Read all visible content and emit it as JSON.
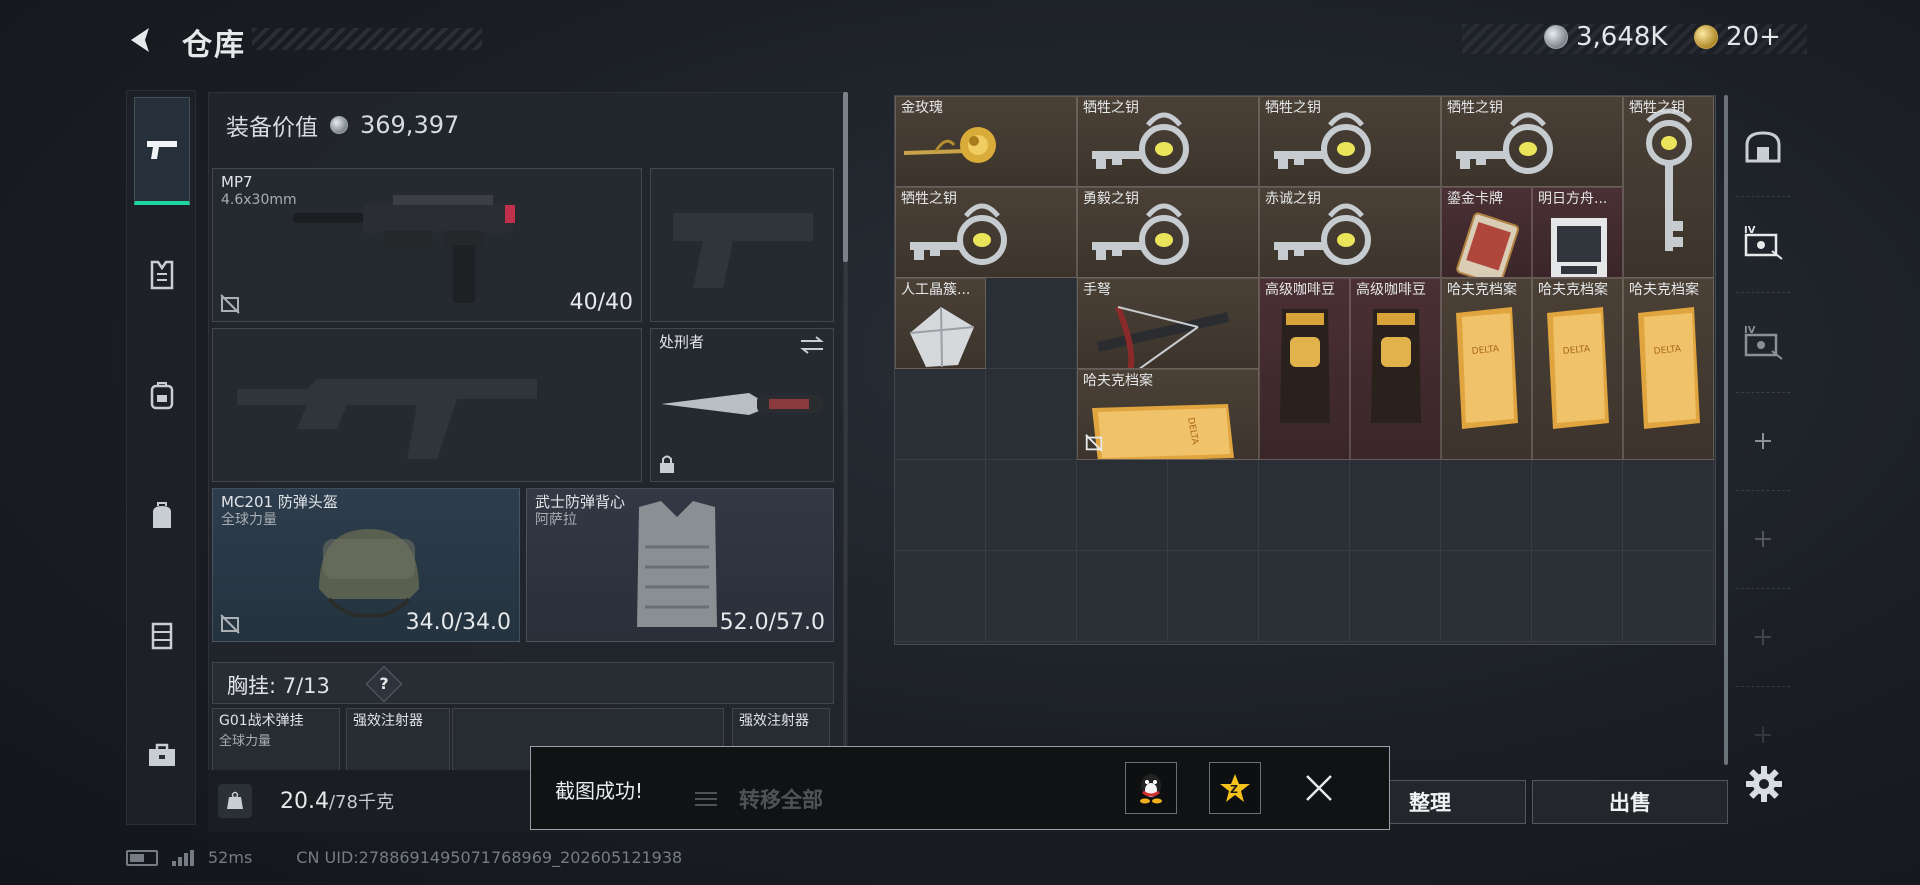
{
  "header": {
    "title": "仓库",
    "currency_1": "3,648K",
    "currency_2": "20+"
  },
  "left_nav": [
    {
      "name": "firearms",
      "icon": "pistol-icon",
      "active": true
    },
    {
      "name": "armor",
      "icon": "vest-icon",
      "active": false
    },
    {
      "name": "backpack",
      "icon": "backpack-icon",
      "active": false
    },
    {
      "name": "bag",
      "icon": "bag-icon",
      "active": false
    },
    {
      "name": "chest-rig",
      "icon": "rig-icon",
      "active": false
    },
    {
      "name": "case",
      "icon": "briefcase-icon",
      "active": false
    }
  ],
  "equipment": {
    "value_label": "装备价值",
    "value": "369,397",
    "primary_weapon": {
      "name": "MP7",
      "ammo": "4.6x30mm",
      "count": "40/40"
    },
    "melee": {
      "name": "处刑者"
    },
    "helmet": {
      "name": "MC201 防弹头盔",
      "sub": "全球力量",
      "durability": "34.0/34.0"
    },
    "vest": {
      "name": "武士防弹背心",
      "sub": "阿萨拉",
      "durability": "52.0/57.0"
    },
    "chest_rig": {
      "label": "胸挂: 7/13",
      "help": "?"
    },
    "rig_items": [
      {
        "name": "G01战术弹挂",
        "sub": "全球力量"
      },
      {
        "name": "强效注射器"
      },
      {
        "name": ""
      },
      {
        "name": "强效注射器"
      }
    ],
    "weight": {
      "value": "20.4",
      "max": "/78千克"
    }
  },
  "storage": {
    "items": [
      {
        "name": "金玫瑰",
        "icon": "gold-rose-icon",
        "color": "brown"
      },
      {
        "name": "牺牲之钥",
        "icon": "key-icon",
        "color": "brown"
      },
      {
        "name": "牺牲之钥",
        "icon": "key-icon",
        "color": "brown"
      },
      {
        "name": "牺牲之钥",
        "icon": "key-icon",
        "color": "brown"
      },
      {
        "name": "牺牲之钥",
        "icon": "key-icon",
        "color": "brown"
      },
      {
        "name": "牺牲之钥",
        "icon": "key-icon",
        "color": "brown"
      },
      {
        "name": "勇毅之钥",
        "icon": "key-icon",
        "color": "brown"
      },
      {
        "name": "赤诚之钥",
        "icon": "key-icon",
        "color": "brown"
      },
      {
        "name": "鎏金卡牌",
        "icon": "card-icon",
        "color": "red"
      },
      {
        "name": "明日方舟...",
        "icon": "book-icon",
        "color": "red"
      },
      {
        "name": "人工晶簇...",
        "icon": "crystal-icon",
        "color": "brown"
      },
      {
        "name": "手弩",
        "icon": "crossbow-icon",
        "color": "brown"
      },
      {
        "name": "高级咖啡豆",
        "icon": "coffee-icon",
        "color": "red"
      },
      {
        "name": "高级咖啡豆",
        "icon": "coffee-icon",
        "color": "red"
      },
      {
        "name": "哈夫克档案",
        "icon": "folder-icon",
        "color": "brown"
      },
      {
        "name": "哈夫克档案",
        "icon": "folder-icon",
        "color": "brown"
      },
      {
        "name": "哈夫克档案",
        "icon": "folder-icon",
        "color": "brown"
      },
      {
        "name": "哈夫克档案",
        "icon": "folder-icon",
        "color": "brown"
      }
    ]
  },
  "actions": {
    "transfer_all": "转移全部",
    "sort": "整理",
    "sell": "出售"
  },
  "toast": {
    "message": "截图成功!"
  },
  "status_bar": {
    "ping": "52ms",
    "uid": "CN UID:2788691495071768969_202605121938"
  },
  "colors": {
    "accent": "#1ed6a0",
    "brown_item": "#4a4036",
    "red_item": "#4a3034"
  }
}
